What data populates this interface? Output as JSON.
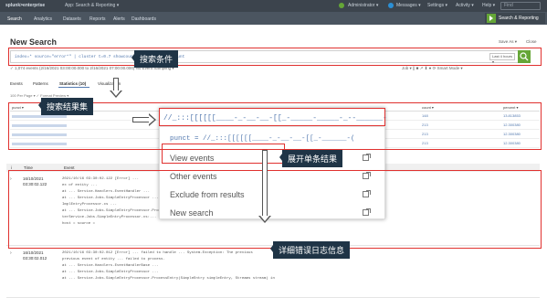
{
  "topbar": {
    "logo": "splunk>enterprise",
    "app": "App: Search & Reporting ▾",
    "admin": "Administrator ▾",
    "messages": "Messages ▾",
    "settings": "Settings ▾",
    "activity": "Activity ▾",
    "help": "Help ▾",
    "find": "Find"
  },
  "nav": {
    "items": [
      "Search",
      "Analytics",
      "Datasets",
      "Reports",
      "Alerts",
      "Dashboards"
    ],
    "app_title": "Search & Reporting"
  },
  "page": {
    "title": "New Search",
    "save_as": "Save As ▾",
    "close": "Close"
  },
  "search": {
    "query": "index=* source=\"error*\" | cluster t=0.7 showcount=true | sort - count",
    "time_picker": "Last 4 hours ▾"
  },
  "status": {
    "left": "✓ 1,074 events (2/16/2021 03:00:00.000 to 2/16/2021 07:00:00.000)  No Event Sampling ▾",
    "right": "Job ▾   ||   ■   ↗   ⬇   ●   ⟳   Smart Mode ▾"
  },
  "tabs": [
    "Events",
    "Patterns",
    "Statistics (10)",
    "Visualization"
  ],
  "results": {
    "per_page": "100 Per Page ▾  ✓ Format  Preview ▾",
    "headers": [
      "punct ▾",
      "",
      "count ▾",
      "percent ▾"
    ],
    "rows": [
      {
        "count": "148",
        "percent": "13.813853"
      },
      {
        "count": "213",
        "percent": "12.300380"
      },
      {
        "count": "213",
        "percent": "12.300380"
      },
      {
        "count": "213",
        "percent": "12.300380"
      }
    ]
  },
  "popup": {
    "punct": "//_:::[[[[[[____-_-__-__-[[_-_____-_____-_--______--(",
    "items": [
      "punct = //_:::[[[[[[____-_-__-__-[[_-______-(",
      "View events",
      "Other events",
      "Exclude from results",
      "New search"
    ]
  },
  "events": {
    "headers": [
      "i",
      "Time",
      "Event"
    ],
    "rows": [
      {
        "time": "16/10/2021\n03:30:02.122",
        "lines": [
          "2021/10/16 03:30:02.122 [Error] ...",
          "ex of entity ...",
          "at ... Service.Handlers.EventHandler ...",
          "at ... Service.Jobs.SimpleEntryProcessor ...",
          "ImplEntryProcessor.cs ...",
          "at ... Service.Jobs.SimpleEntryProcessor.ProcessEntry(SimpleEntry simpleEntry)",
          "terService.Jobs.SimpleEntryProcessor.cs:..."
        ],
        "fields": "host =  source = "
      },
      {
        "time": "16/10/2021\n03:30:02.012",
        "lines": [
          "2021/10/16 03:30:02.012 [Error] ... failed to handle ... System.Exception: The previous",
          "previous event of entity ... failed to process.",
          "at ... Service.Handlers.EventHandlerBase ...",
          "at ... Service.Jobs.SimpleEntryProcessor ...",
          "at ... Service.Jobs.SimpleEntryProcessor.ProcessEntry(SimpleEntry simpleEntry, Streams stream) in"
        ],
        "fields": ""
      }
    ]
  },
  "annotations": {
    "search_criteria": "搜索条件",
    "result_set": "搜索结果集",
    "expand_single": "展开单条结果",
    "error_detail": "详细错误日志信息"
  },
  "colors": {
    "highlight": "#e0312f",
    "callout": "#1f3446",
    "accent": "#5379af",
    "go": "#65a637"
  }
}
